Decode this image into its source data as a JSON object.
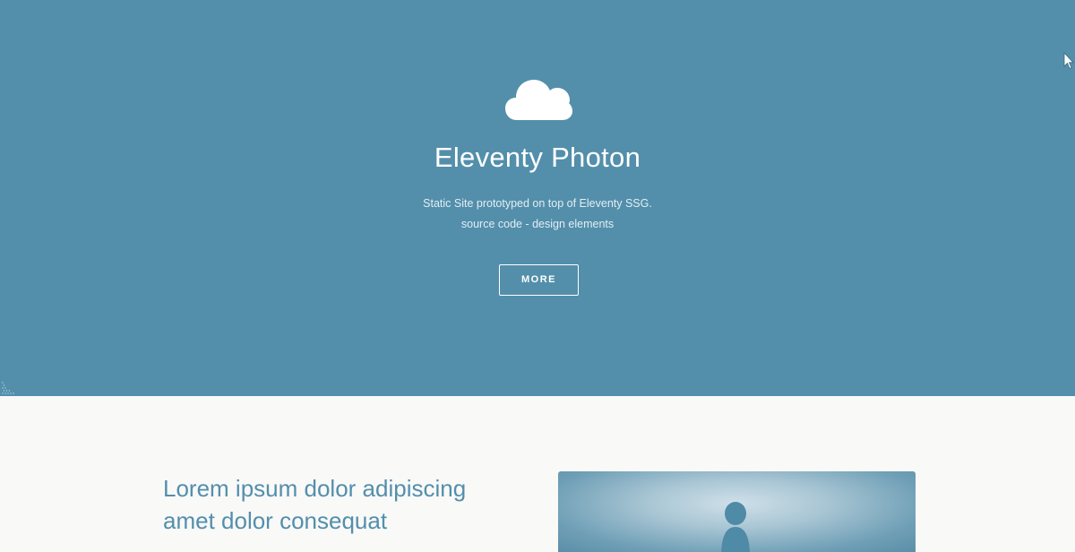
{
  "header": {
    "title": "Eleventy Photon",
    "subtitle_line1": "Static Site prototyped on top of Eleventy SSG.",
    "source_code_link": "source code",
    "separator": " - ",
    "design_elements_link": "design elements",
    "more_button": "MORE",
    "icon": "cloud-icon",
    "background_color": "#538fab"
  },
  "main": {
    "heading": "Lorem ipsum dolor adipiscing amet dolor consequat",
    "heading_color": "#538fab"
  }
}
